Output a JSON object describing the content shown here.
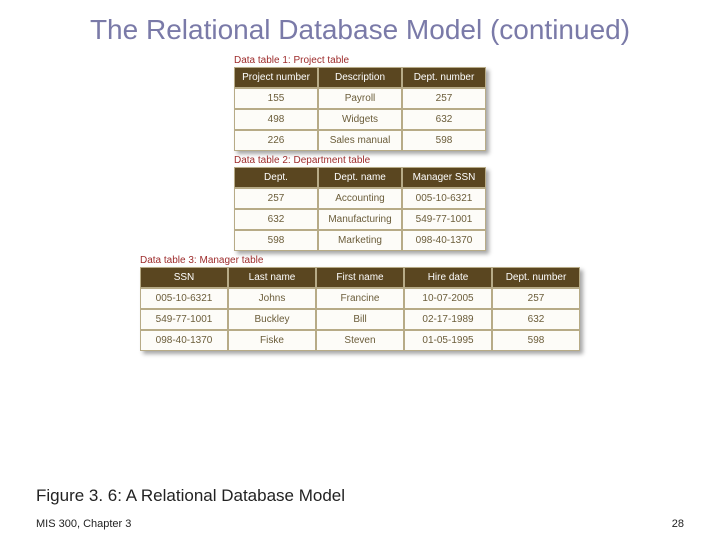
{
  "title": "The Relational Database Model (continued)",
  "table1": {
    "caption": "Data table 1: Project table",
    "headers": [
      "Project number",
      "Description",
      "Dept. number"
    ],
    "rows": [
      [
        "155",
        "Payroll",
        "257"
      ],
      [
        "498",
        "Widgets",
        "632"
      ],
      [
        "226",
        "Sales manual",
        "598"
      ]
    ]
  },
  "table2": {
    "caption": "Data table 2: Department table",
    "headers": [
      "Dept.",
      "Dept. name",
      "Manager SSN"
    ],
    "rows": [
      [
        "257",
        "Accounting",
        "005-10-6321"
      ],
      [
        "632",
        "Manufacturing",
        "549-77-1001"
      ],
      [
        "598",
        "Marketing",
        "098-40-1370"
      ]
    ]
  },
  "table3": {
    "caption": "Data table 3: Manager table",
    "headers": [
      "SSN",
      "Last name",
      "First name",
      "Hire date",
      "Dept. number"
    ],
    "rows": [
      [
        "005-10-6321",
        "Johns",
        "Francine",
        "10-07-2005",
        "257"
      ],
      [
        "549-77-1001",
        "Buckley",
        "Bill",
        "02-17-1989",
        "632"
      ],
      [
        "098-40-1370",
        "Fiske",
        "Steven",
        "01-05-1995",
        "598"
      ]
    ]
  },
  "figure_caption": "Figure 3. 6: A Relational Database Model",
  "footer_left": "MIS 300, Chapter 3",
  "footer_right": "28"
}
